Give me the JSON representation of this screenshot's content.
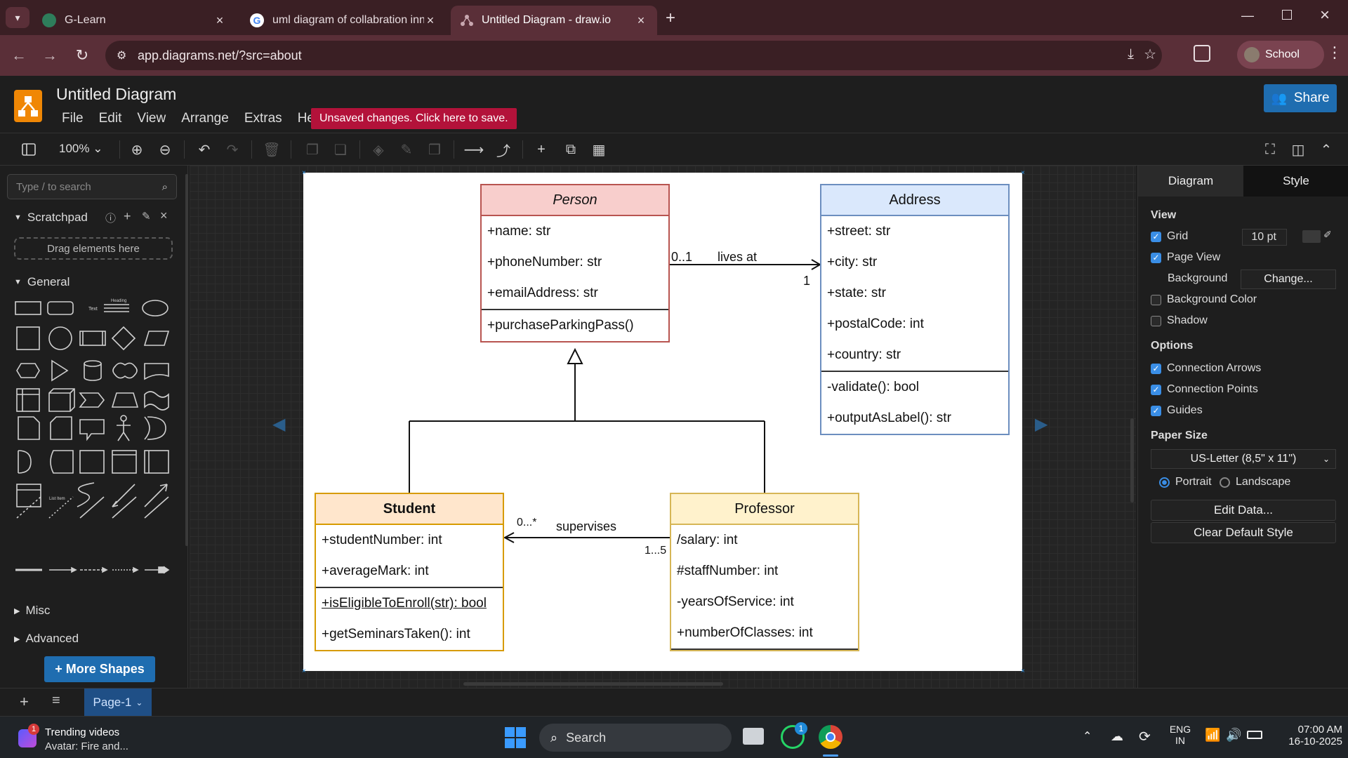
{
  "browser": {
    "tabs": [
      {
        "title": "G-Learn",
        "active": false
      },
      {
        "title": "uml diagram of collabration inn",
        "active": false
      },
      {
        "title": "Untitled Diagram - draw.io",
        "active": true
      }
    ],
    "url": "app.diagrams.net/?src=about",
    "profile_label": "School"
  },
  "app": {
    "title": "Untitled Diagram",
    "menu": [
      "File",
      "Edit",
      "View",
      "Arrange",
      "Extras",
      "Help"
    ],
    "unsaved_notice": "Unsaved changes. Click here to save.",
    "share_label": "Share",
    "zoom": "100%"
  },
  "sidebar": {
    "search_placeholder": "Type / to search",
    "scratchpad_label": "Scratchpad",
    "drop_hint": "Drag elements here",
    "general_label": "General",
    "misc_label": "Misc",
    "advanced_label": "Advanced",
    "more_shapes_label": "+ More Shapes",
    "shape_text_1": "Text",
    "shape_text_2": "Heading",
    "shape_text_3": "List Item"
  },
  "diagram": {
    "person": {
      "name": "Person",
      "attributes": [
        "+name: str",
        "+phoneNumber: str",
        "+emailAddress: str"
      ],
      "methods": [
        "+purchaseParkingPass()"
      ]
    },
    "address": {
      "name": "Address",
      "attributes": [
        "+street: str",
        "+city: str",
        "+state: str",
        "+postalCode: int",
        "+country: str"
      ],
      "methods": [
        "-validate(): bool",
        "+outputAsLabel(): str"
      ]
    },
    "student": {
      "name": "Student",
      "attributes": [
        "+studentNumber: int",
        "+averageMark: int"
      ],
      "methods": [
        "+isEligibleToEnroll(str): bool",
        "+getSeminarsTaken(): int"
      ]
    },
    "professor": {
      "name": "Professor",
      "attributes": [
        "/salary: int",
        "#staffNumber: int",
        "-yearsOfService: int",
        "+numberOfClasses: int"
      ]
    },
    "assoc_lives_at": {
      "label": "lives at",
      "source_mult": "0..1",
      "target_mult": "1"
    },
    "assoc_supervises": {
      "label": "supervises",
      "source_mult": "0...*",
      "target_mult": "1...5"
    }
  },
  "format_panel": {
    "tabs": [
      "Diagram",
      "Style"
    ],
    "view_heading": "View",
    "grid_label": "Grid",
    "grid_checked": true,
    "grid_size": "10 pt",
    "page_view_label": "Page View",
    "page_view_checked": true,
    "background_label": "Background",
    "change_label": "Change...",
    "background_color_label": "Background Color",
    "background_color_checked": false,
    "shadow_label": "Shadow",
    "shadow_checked": false,
    "options_heading": "Options",
    "connection_arrows_label": "Connection Arrows",
    "connection_points_label": "Connection Points",
    "guides_label": "Guides",
    "paper_size_heading": "Paper Size",
    "paper_size_value": "US-Letter (8,5\" x 11\")",
    "portrait_label": "Portrait",
    "landscape_label": "Landscape",
    "orientation": "Portrait",
    "edit_data_label": "Edit Data...",
    "clear_style_label": "Clear Default Style"
  },
  "pages": {
    "current": "Page-1"
  },
  "taskbar": {
    "news_title": "Trending videos",
    "news_subtitle": "Avatar: Fire and...",
    "news_badge": "1",
    "search_label": "Search",
    "whatsapp_badge": "1",
    "lang_top": "ENG",
    "lang_bottom": "IN",
    "time": "07:00 AM",
    "date": "16-10-2025"
  },
  "colors": {
    "accent": "#1f6db0",
    "unsaved": "#b3123a",
    "person_header": "#f8cecc",
    "address_header": "#dae8fc",
    "student_header": "#ffe6cc",
    "professor_header": "#fff2cc"
  }
}
